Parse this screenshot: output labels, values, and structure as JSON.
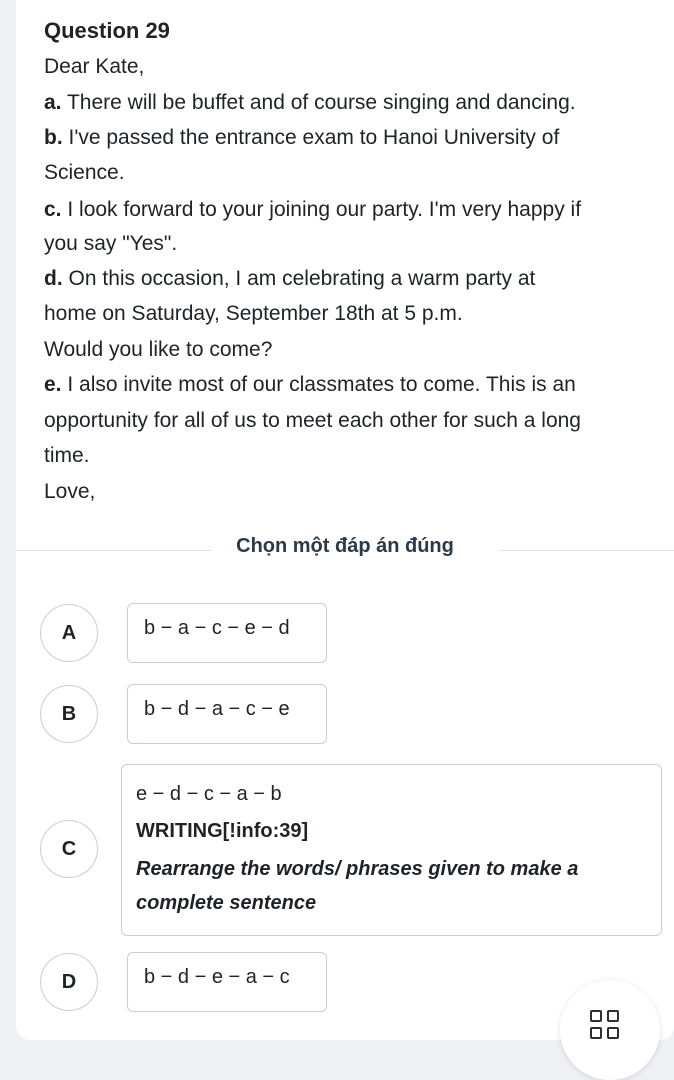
{
  "question": {
    "title": "Question 29",
    "greeting": "Dear Kate,",
    "items": [
      {
        "letter": "a.",
        "lines": [
          "There will be buffet and of course singing and dancing."
        ]
      },
      {
        "letter": "b.",
        "lines": [
          "I've passed the entrance exam to Hanoi University of",
          "Science."
        ]
      },
      {
        "letter": "c.",
        "lines": [
          "I look forward to your joining our party. I'm very happy if",
          "you say \"Yes\"."
        ]
      },
      {
        "letter": "d.",
        "lines": [
          "On this occasion, I am celebrating a warm party at",
          "home on Saturday, September 18th at 5 p.m.",
          "Would you like to come?"
        ]
      },
      {
        "letter": "e.",
        "lines": [
          "I also invite most of our classmates to come. This is an",
          "opportunity for all of us to meet each other for such a long",
          "time."
        ]
      }
    ],
    "closing": "Love,"
  },
  "prompt": "Chọn một đáp án đúng",
  "options": [
    {
      "label": "A",
      "sequence": "b − a − c − e − d"
    },
    {
      "label": "B",
      "sequence": "b − d − a − c − e"
    },
    {
      "label": "C",
      "sequence": "e − d − c − a − b",
      "extra_title": "WRITING[!info:39]",
      "extra_instruction_1": "Rearrange the words/ phrases given to make a",
      "extra_instruction_2": "complete sentence"
    },
    {
      "label": "D",
      "sequence": "b − d − e − a − c"
    }
  ],
  "icons": {
    "menu": "grid-icon"
  }
}
